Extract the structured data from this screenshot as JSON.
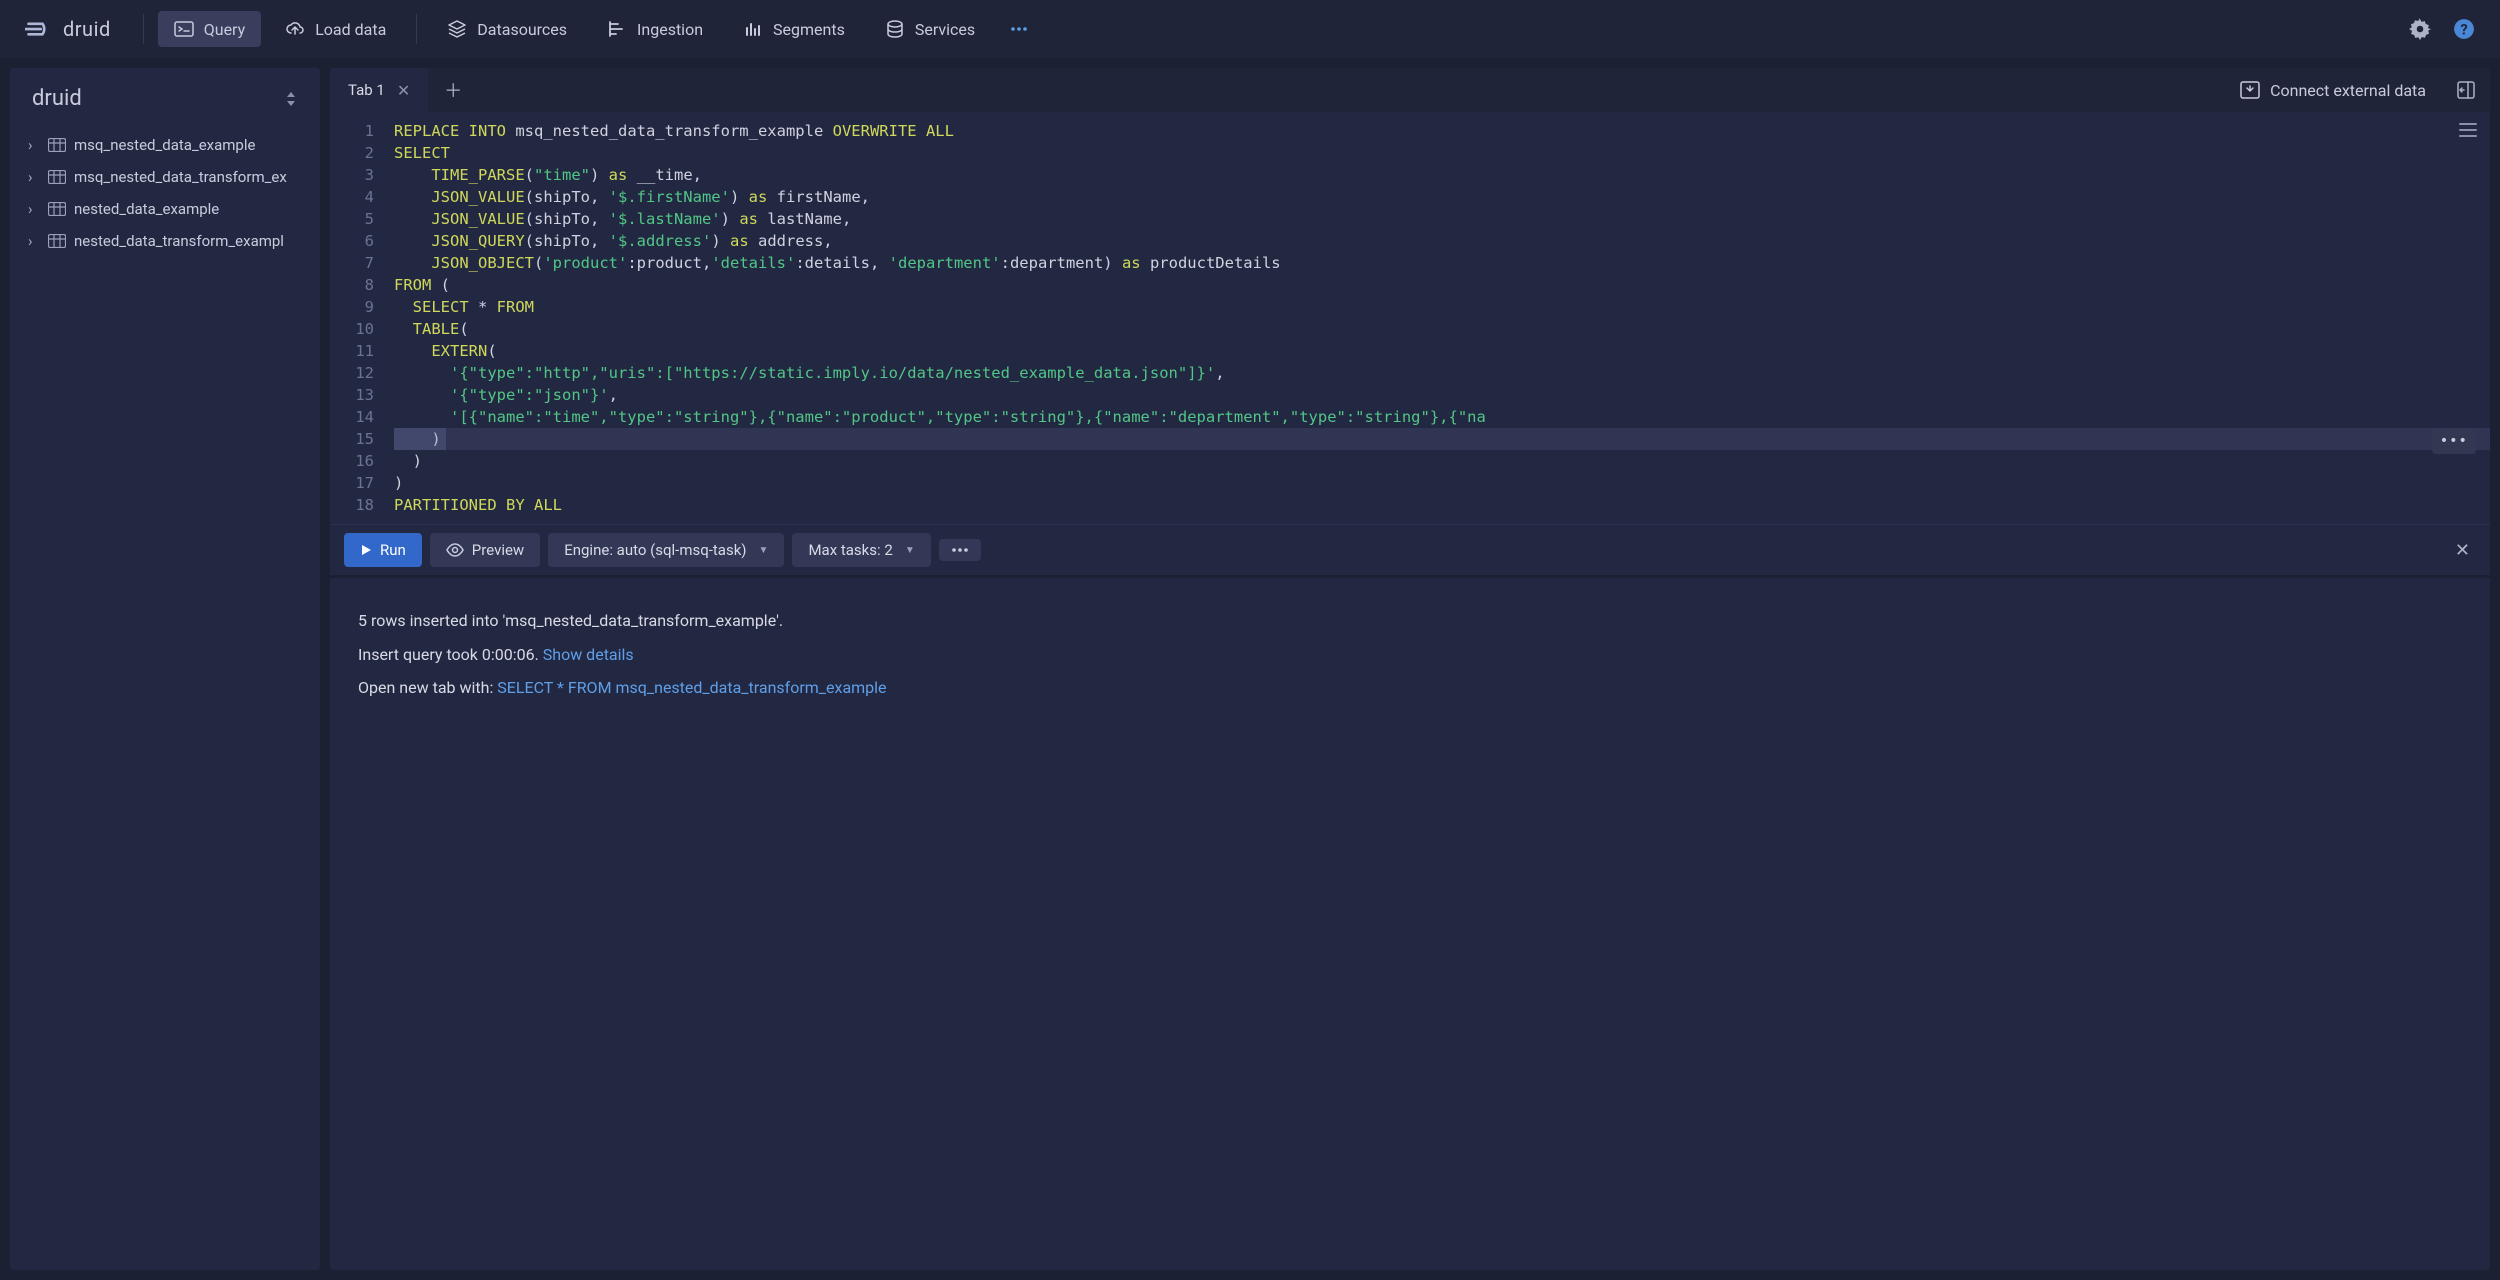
{
  "brand": "druid",
  "nav": {
    "query": "Query",
    "load_data": "Load data",
    "datasources": "Datasources",
    "ingestion": "Ingestion",
    "segments": "Segments",
    "services": "Services"
  },
  "sidebar": {
    "database": "druid",
    "items": [
      {
        "label": "msq_nested_data_example"
      },
      {
        "label": "msq_nested_data_transform_ex"
      },
      {
        "label": "nested_data_example"
      },
      {
        "label": "nested_data_transform_exampl"
      }
    ]
  },
  "tabs": {
    "tab1": "Tab 1",
    "connect_external": "Connect external data"
  },
  "editor": {
    "line_count": 18,
    "highlighted_line": 15,
    "tokens": [
      [
        [
          "kw",
          "REPLACE"
        ],
        [
          "p",
          " "
        ],
        [
          "kw",
          "INTO"
        ],
        [
          "p",
          " msq_nested_data_transform_example "
        ],
        [
          "kw",
          "OVERWRITE"
        ],
        [
          "p",
          " "
        ],
        [
          "kw",
          "ALL"
        ]
      ],
      [
        [
          "kw",
          "SELECT"
        ]
      ],
      [
        [
          "p",
          "    "
        ],
        [
          "fn",
          "TIME_PARSE"
        ],
        [
          "p",
          "("
        ],
        [
          "str",
          "\"time\""
        ],
        [
          "p",
          ") "
        ],
        [
          "kw",
          "as"
        ],
        [
          "p",
          " __time,"
        ]
      ],
      [
        [
          "p",
          "    "
        ],
        [
          "fn",
          "JSON_VALUE"
        ],
        [
          "p",
          "(shipTo, "
        ],
        [
          "str",
          "'$.firstName'"
        ],
        [
          "p",
          ") "
        ],
        [
          "kw",
          "as"
        ],
        [
          "p",
          " firstName,"
        ]
      ],
      [
        [
          "p",
          "    "
        ],
        [
          "fn",
          "JSON_VALUE"
        ],
        [
          "p",
          "(shipTo, "
        ],
        [
          "str",
          "'$.lastName'"
        ],
        [
          "p",
          ") "
        ],
        [
          "kw",
          "as"
        ],
        [
          "p",
          " lastName,"
        ]
      ],
      [
        [
          "p",
          "    "
        ],
        [
          "fn",
          "JSON_QUERY"
        ],
        [
          "p",
          "(shipTo, "
        ],
        [
          "str",
          "'$.address'"
        ],
        [
          "p",
          ") "
        ],
        [
          "kw",
          "as"
        ],
        [
          "p",
          " address,"
        ]
      ],
      [
        [
          "p",
          "    "
        ],
        [
          "fn",
          "JSON_OBJECT"
        ],
        [
          "p",
          "("
        ],
        [
          "str",
          "'product'"
        ],
        [
          "p",
          ":product,"
        ],
        [
          "str",
          "'details'"
        ],
        [
          "p",
          ":details, "
        ],
        [
          "str",
          "'department'"
        ],
        [
          "p",
          ":department) "
        ],
        [
          "kw",
          "as"
        ],
        [
          "p",
          " productDetails"
        ]
      ],
      [
        [
          "kw",
          "FROM"
        ],
        [
          "p",
          " ("
        ]
      ],
      [
        [
          "p",
          "  "
        ],
        [
          "kw",
          "SELECT"
        ],
        [
          "p",
          " * "
        ],
        [
          "kw",
          "FROM"
        ]
      ],
      [
        [
          "p",
          "  "
        ],
        [
          "fn",
          "TABLE"
        ],
        [
          "p",
          "("
        ]
      ],
      [
        [
          "p",
          "    "
        ],
        [
          "fn",
          "EXTERN"
        ],
        [
          "p",
          "("
        ]
      ],
      [
        [
          "p",
          "      "
        ],
        [
          "str",
          "'{\"type\":\"http\",\"uris\":[\"https://static.imply.io/data/nested_example_data.json\"]}'"
        ],
        [
          "p",
          ","
        ]
      ],
      [
        [
          "p",
          "      "
        ],
        [
          "str",
          "'{\"type\":\"json\"}'"
        ],
        [
          "p",
          ","
        ]
      ],
      [
        [
          "p",
          "      "
        ],
        [
          "str",
          "'[{\"name\":\"time\",\"type\":\"string\"},{\"name\":\"product\",\"type\":\"string\"},{\"name\":\"department\",\"type\":\"string\"},{\"na"
        ]
      ],
      [
        [
          "p",
          "    )"
        ]
      ],
      [
        [
          "p",
          "  )"
        ]
      ],
      [
        [
          "p",
          ")"
        ]
      ],
      [
        [
          "kw",
          "PARTITIONED"
        ],
        [
          "p",
          " "
        ],
        [
          "kw",
          "BY"
        ],
        [
          "p",
          " "
        ],
        [
          "kw",
          "ALL"
        ]
      ]
    ]
  },
  "toolbar": {
    "run": "Run",
    "preview": "Preview",
    "engine": "Engine: auto (sql-msq-task)",
    "max_tasks": "Max tasks: 2"
  },
  "results": {
    "line1": "5 rows inserted into 'msq_nested_data_transform_example'.",
    "line2_prefix": "Insert query took 0:00:06. ",
    "line2_link": "Show details",
    "line3_prefix": "Open new tab with: ",
    "line3_link": "SELECT * FROM msq_nested_data_transform_example"
  }
}
